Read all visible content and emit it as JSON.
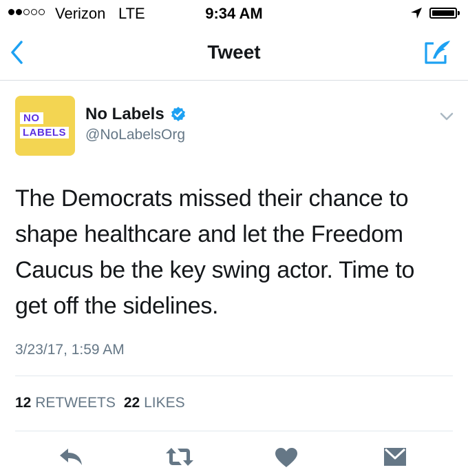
{
  "status_bar": {
    "signal_dots_filled": 2,
    "signal_dots_total": 5,
    "carrier": "Verizon",
    "network": "LTE",
    "time": "9:34 AM",
    "location_icon": "location-arrow-icon",
    "battery_level": 1.0
  },
  "nav": {
    "back_icon": "chevron-left-icon",
    "title": "Tweet",
    "compose_icon": "compose-icon"
  },
  "author": {
    "avatar_text_line1": "NO",
    "avatar_text_line2": "LABELS",
    "avatar_bg": "#f3d552",
    "avatar_text_color": "#5b30e0",
    "display_name": "No Labels",
    "verified": true,
    "handle": "@NoLabelsOrg"
  },
  "tweet": {
    "text": "The Democrats missed their chance to shape healthcare and let the Freedom Caucus be the key swing actor. Time to get off the sidelines.",
    "timestamp": "3/23/17, 1:59 AM"
  },
  "stats": {
    "retweets_count": "12",
    "retweets_label": "RETWEETS",
    "likes_count": "22",
    "likes_label": "LIKES"
  },
  "actions": [
    "reply-icon",
    "retweet-icon",
    "like-icon",
    "direct-message-icon"
  ],
  "colors": {
    "accent": "#1da1f2",
    "icon_gray": "#657786",
    "text": "#14171a",
    "divider": "#e1e8ed"
  }
}
